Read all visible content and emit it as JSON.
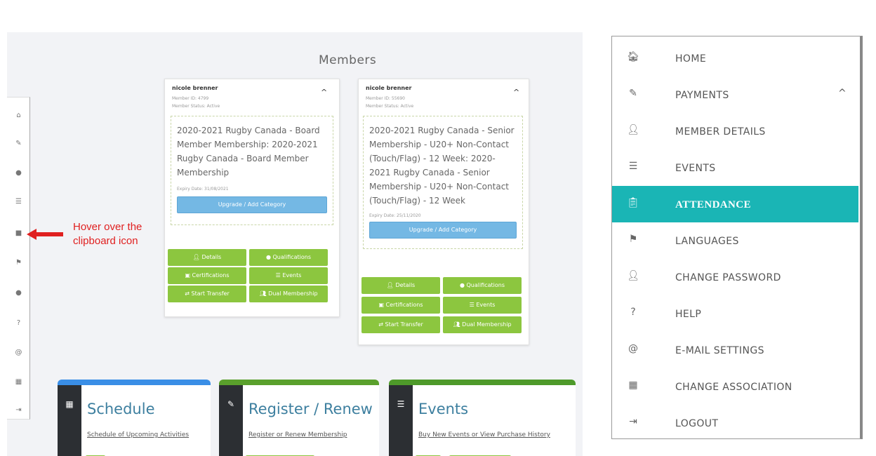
{
  "members_page": {
    "title": "Members",
    "mini_sidebar_icons": [
      "home-icon",
      "edit-icon",
      "user-icon",
      "list-icon",
      "clipboard-icon",
      "flag-icon",
      "user-icon",
      "help-icon",
      "at-icon",
      "building-icon",
      "logout-icon"
    ],
    "annotation": {
      "text": "Hover over the clipboard icon",
      "color": "#e02020"
    },
    "cards": [
      {
        "name": "nicole brenner",
        "member_id": "Member ID: 4799",
        "member_status": "Member Status: Active",
        "membership": "2020-2021 Rugby Canada - Board Member Membership: 2020-2021 Rugby Canada - Board Member Membership",
        "expiry": "Expiry Date: 31/08/2021",
        "upgrade_label": "Upgrade / Add Category",
        "buttons": {
          "details": "Details",
          "qualifications": "Qualifications",
          "certifications": "Certifications",
          "events": "Events",
          "start_transfer": "Start Transfer",
          "dual_membership": "Dual Membership"
        }
      },
      {
        "name": "nicole brenner",
        "member_id": "Member ID: 55690",
        "member_status": "Member Status: Active",
        "membership": "2020-2021 Rugby Canada - Senior Membership - U20+ Non-Contact (Touch/Flag) - 12 Week: 2020-2021 Rugby Canada - Senior Membership - U20+ Non-Contact (Touch/Flag) - 12 Week",
        "expiry": "Expiry Date: 25/11/2020",
        "upgrade_label": "Upgrade / Add Category",
        "buttons": {
          "details": "Details",
          "qualifications": "Qualifications",
          "certifications": "Certifications",
          "events": "Events",
          "start_transfer": "Start Transfer",
          "dual_membership": "Dual Membership"
        }
      }
    ],
    "tiles": [
      {
        "heading": "Schedule",
        "sub": "Schedule of Upcoming Activities",
        "icon": "calendar-icon",
        "color": "#3a8ee6"
      },
      {
        "heading": "Register / Renew",
        "sub": "Register or Renew Membership",
        "icon": "user-edit-icon",
        "color": "#5aa02c"
      },
      {
        "heading": "Events",
        "sub": "Buy New Events or View Purchase History",
        "icon": "list-icon",
        "color": "#4e9a2a"
      }
    ]
  },
  "menu": {
    "items": [
      {
        "label": "HOME",
        "icon": "home-icon",
        "glyph": "🏠︎"
      },
      {
        "label": "PAYMENTS",
        "icon": "edit-icon",
        "glyph": "✎",
        "chevron": "^"
      },
      {
        "label": "MEMBER DETAILS",
        "icon": "user-icon",
        "glyph": "👤︎"
      },
      {
        "label": "EVENTS",
        "icon": "list-icon",
        "glyph": "☰"
      },
      {
        "label": "ATTENDANCE",
        "icon": "clipboard-icon",
        "glyph": "📋︎",
        "active": true
      },
      {
        "label": "LANGUAGES",
        "icon": "flag-icon",
        "glyph": "⚑"
      },
      {
        "label": "CHANGE PASSWORD",
        "icon": "user-icon",
        "glyph": "👤︎"
      },
      {
        "label": "HELP",
        "icon": "help-icon",
        "glyph": "?"
      },
      {
        "label": "E-MAIL SETTINGS",
        "icon": "at-icon",
        "glyph": "@"
      },
      {
        "label": "CHANGE ASSOCIATION",
        "icon": "building-icon",
        "glyph": "▦"
      },
      {
        "label": "LOGOUT",
        "icon": "logout-icon",
        "glyph": "⇥"
      }
    ],
    "active_color": "#1ab5b5"
  }
}
